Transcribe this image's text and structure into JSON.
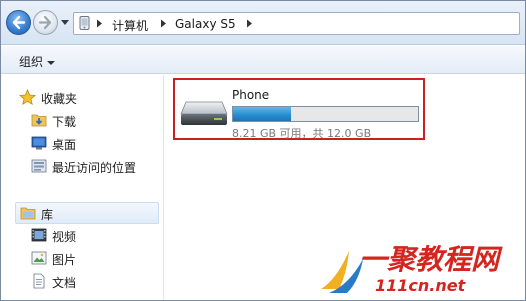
{
  "address_bar": {
    "breadcrumbs": [
      "计算机",
      "Galaxy S5"
    ],
    "icons": [
      "back-arrow-icon",
      "forward-arrow-icon",
      "history-dropdown-icon",
      "device-icon",
      "chevron-right-icon"
    ]
  },
  "toolbar": {
    "organize_label": "组织"
  },
  "nav": {
    "favorites": {
      "label": "收藏夹",
      "items": [
        {
          "label": "下载",
          "icon": "download-folder-icon"
        },
        {
          "label": "桌面",
          "icon": "desktop-icon"
        },
        {
          "label": "最近访问的位置",
          "icon": "recent-places-icon"
        }
      ]
    },
    "libraries": {
      "label": "库",
      "items": [
        {
          "label": "视频",
          "icon": "video-library-icon"
        },
        {
          "label": "图片",
          "icon": "pictures-library-icon"
        },
        {
          "label": "文档",
          "icon": "documents-library-icon"
        }
      ]
    }
  },
  "content": {
    "drive": {
      "name": "Phone",
      "used_fraction": 0.3158,
      "free_text": "8.21 GB 可用，共 12.0 GB",
      "icon": "drive-icon",
      "highlight_color": "#cc1f1f"
    }
  },
  "watermark": {
    "title": "一聚教程网",
    "url": "www.111cn.net",
    "color": "#d4251f"
  }
}
